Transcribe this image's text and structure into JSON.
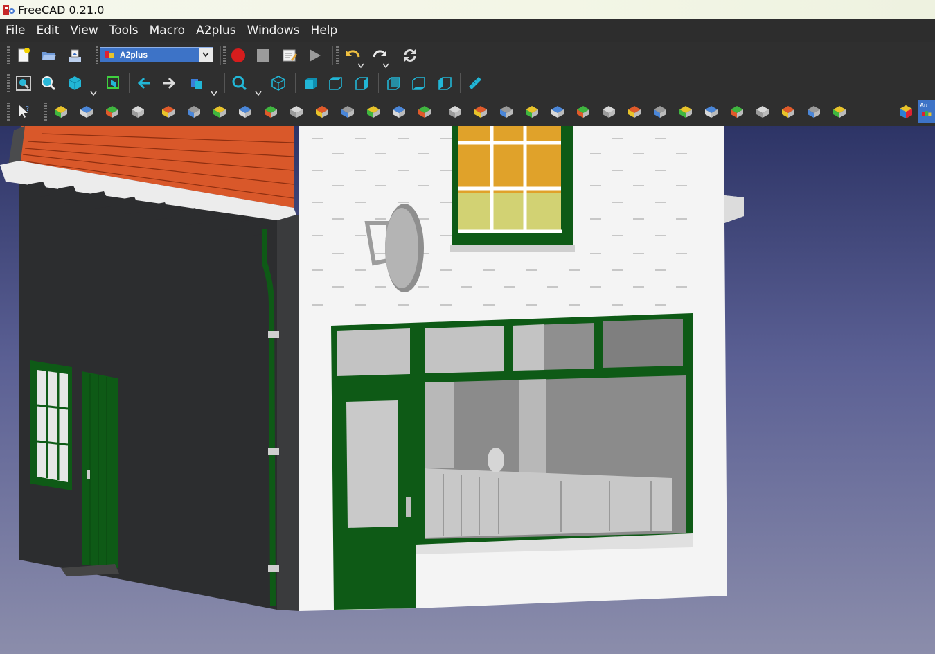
{
  "window": {
    "title": "FreeCAD 0.21.0"
  },
  "menu": [
    "File",
    "Edit",
    "View",
    "Tools",
    "Macro",
    "A2plus",
    "Windows",
    "Help"
  ],
  "workbench_selector": {
    "value": "A2plus"
  },
  "toolbar_partial_label": "Au",
  "colors": {
    "accent": "#3d73c7",
    "menubar": "#2d2d2d",
    "toolbar": "#2f2f2f",
    "titlebar": "#f4f6ea",
    "door_green": "#0e5a16",
    "roof": "#d9582a"
  },
  "icons": {
    "file_toolbar": [
      "new-document-icon",
      "open-document-icon",
      "save-document-icon"
    ],
    "macro_toolbar": [
      "record-macro-icon",
      "stop-macro-icon",
      "edit-macro-icon",
      "run-macro-icon"
    ],
    "edit_toolbar": [
      "undo-icon",
      "redo-icon",
      "refresh-icon"
    ],
    "view_toolbar": [
      "fit-all-icon",
      "fit-selection-icon",
      "draw-style-icon",
      "bounding-box-icon",
      "back-icon",
      "forward-icon",
      "sync-view-icon",
      "zoom-icon",
      "isometric-icon",
      "front-view-icon",
      "top-view-icon",
      "right-view-icon",
      "rear-view-icon",
      "bottom-view-icon",
      "left-view-icon",
      "measure-icon"
    ],
    "a2plus_toolbar": [
      "what-this-icon",
      "add-part-icon",
      "open-folder-icon",
      "import-part-icon",
      "edit-part-icon",
      "update-assembly-icon",
      "update-all-icon",
      "solve-icon",
      "multi-part-icon",
      "duplicate-icon",
      "convert-part-icon",
      "show-dof-icon",
      "move-part-icon",
      "constraint-point-icon",
      "constraint-point-edge-icon",
      "constraint-point-plane-icon",
      "delete-constraint-icon",
      "sphere-constraint-icon",
      "point-on-line-icon",
      "circular-edge-icon",
      "axial-icon",
      "axis-parallel-icon",
      "axis-plane-parallel-icon",
      "parallel-lines-icon",
      "planes-parallel-icon",
      "angled-planes-icon",
      "plane-coincident-icon",
      "perpendicular-icon",
      "center-of-mass-icon",
      "axis-plane-angle-icon",
      "axis-plane-normal-icon",
      "plane-normal-icon",
      "cube-color-icon",
      "auto-icon"
    ]
  }
}
